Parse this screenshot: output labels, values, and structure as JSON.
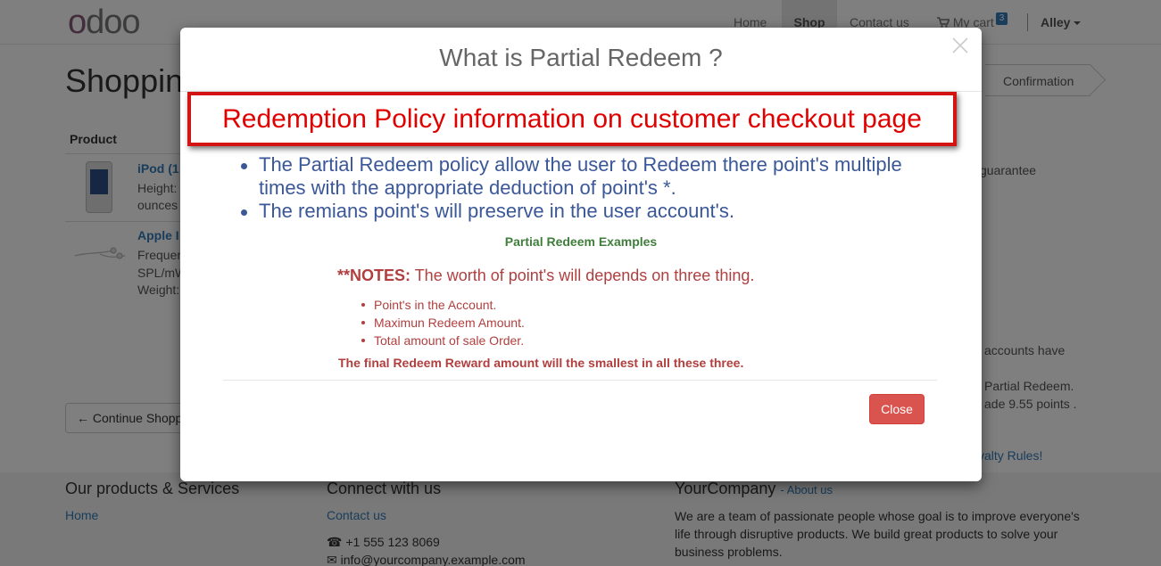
{
  "navbar": {
    "logo": "odoo",
    "items": [
      "Home",
      "Shop",
      "Contact us"
    ],
    "cart_label": "My cart",
    "cart_count": "3",
    "user": "Alley"
  },
  "page": {
    "title": "Shoppin",
    "progress_step": "Confirmation",
    "product_header": "Product",
    "products": [
      {
        "name": "iPod (1",
        "desc": [
          "Height:",
          "ounces"
        ]
      },
      {
        "name": "Apple I",
        "desc": [
          "Frequer",
          "SPL/mW",
          "Weight:"
        ]
      }
    ],
    "continue_label": "Continue Shopp",
    "side_lines": [
      "guarantee",
      "accounts have",
      "Partial Redeem.",
      "ade 9.55 points ."
    ],
    "side_link": "yalty Rules!"
  },
  "footer": {
    "col1": {
      "title": "Our products & Services",
      "link": "Home"
    },
    "col2": {
      "title": "Connect with us",
      "link": "Contact us",
      "phone": "+1 555 123 8069",
      "email": "info@yourcompany.example.com"
    },
    "col3": {
      "title": "YourCompany",
      "about_link": "- About us",
      "text": "We are a team of passionate people whose goal is to improve everyone's life through disruptive products. We build great products to solve your business problems."
    }
  },
  "modal": {
    "title": "What is Partial Redeem ?",
    "callout": "Redemption Policy information on customer checkout page",
    "points": [
      "The Partial Redeem policy allow the user to Redeem there point's multiple times with the appropriate deduction of point's *.",
      "The remians point's will preserve in the user account's."
    ],
    "examples_title": "Partial Redeem Examples",
    "notes_label": "**NOTES:",
    "notes_text": " The worth of point's will depends on three thing.",
    "notes_items": [
      "Point's in the Account.",
      "Maximun Redeem Amount.",
      "Total amount of sale Order."
    ],
    "final_line": "The final Redeem Reward amount will the smallest in all these three.",
    "close_label": "Close"
  }
}
